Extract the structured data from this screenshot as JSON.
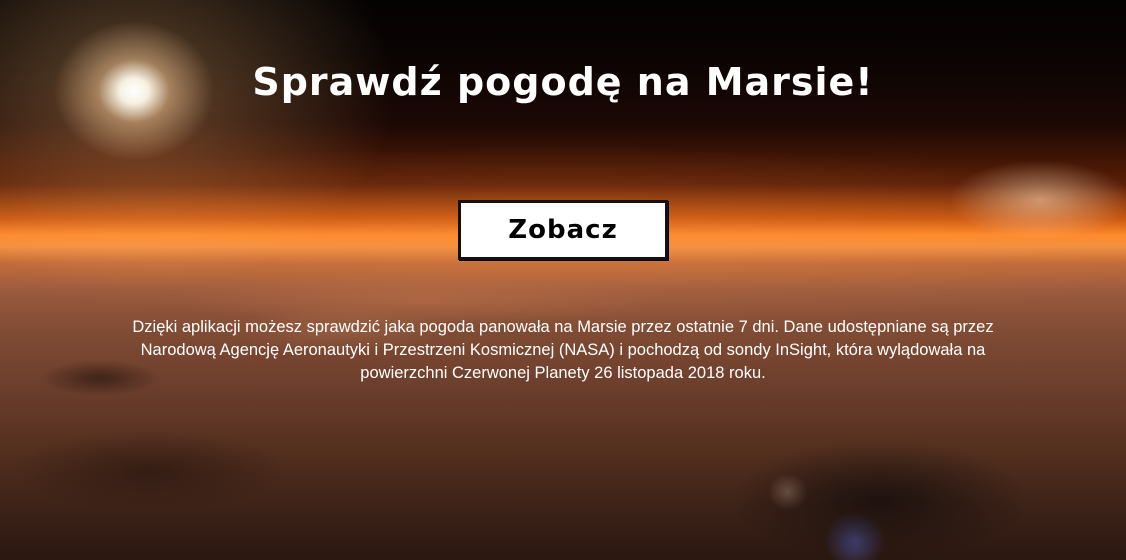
{
  "hero": {
    "title": "Sprawdź pogodę na Marsie!",
    "button_label": "Zobacz",
    "description": "Dzięki aplikacji możesz sprawdzić jaka pogoda panowała na Marsie przez ostatnie 7 dni. Dane udostępniane są przez Narodową Agencję Aeronautyki i Przestrzeni Kosmicznej (NASA) i pochodzą od sondy InSight, która wylądowała na powierzchni Czerwonej Planety 26 listopada 2018 roku."
  },
  "colors": {
    "text": "#ffffff",
    "button_bg": "#ffffff",
    "button_border": "#111111",
    "mars_glow": "#ff8a2a"
  }
}
